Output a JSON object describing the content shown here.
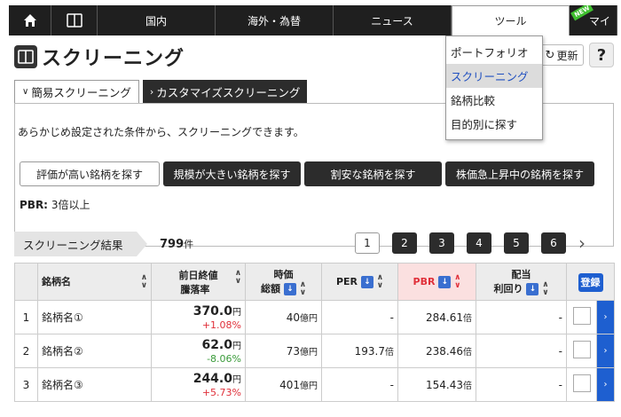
{
  "nav": {
    "items": [
      "国内",
      "海外・為替",
      "ニュース",
      "ツール"
    ],
    "extra": "マイ",
    "new_badge": "NEW"
  },
  "title": "スクリーニング",
  "refresh_label": "更新",
  "help_label": "?",
  "tabs": {
    "simple": "簡易スクリーニング",
    "custom": "カスタマイズスクリーニング"
  },
  "description": "あらかじめ設定された条件から、スクリーニングできます。",
  "presets": [
    "評価が高い銘柄を探す",
    "規模が大きい銘柄を探す",
    "割安な銘柄を探す",
    "株価急上昇中の銘柄を探す"
  ],
  "condition": {
    "label": "PBR:",
    "value": "3倍以上"
  },
  "results": {
    "label": "スクリーニング結果",
    "count": "799",
    "count_unit": "件"
  },
  "pager": [
    "1",
    "2",
    "3",
    "4",
    "5",
    "6"
  ],
  "table": {
    "headers": {
      "name": "銘柄名",
      "price_line1": "前日終値",
      "price_line2": "騰落率",
      "mcap_line1": "時価",
      "mcap_line2": "総額",
      "per": "PER",
      "pbr": "PBR",
      "div_line1": "配当",
      "div_line2": "利回り",
      "register": "登録"
    },
    "rows": [
      {
        "idx": "1",
        "name": "銘柄名①",
        "price": "370.0",
        "price_unit": "円",
        "change": "+1.08%",
        "mcap": "40",
        "mcap_unit": "億円",
        "per": "-",
        "per_unit": "",
        "pbr": "284.61",
        "pbr_unit": "倍",
        "div": "-"
      },
      {
        "idx": "2",
        "name": "銘柄名②",
        "price": "62.0",
        "price_unit": "円",
        "change": "-8.06%",
        "mcap": "73",
        "mcap_unit": "億円",
        "per": "193.7",
        "per_unit": "倍",
        "pbr": "238.46",
        "pbr_unit": "倍",
        "div": "-"
      },
      {
        "idx": "3",
        "name": "銘柄名③",
        "price": "244.0",
        "price_unit": "円",
        "change": "+5.73%",
        "mcap": "401",
        "mcap_unit": "億円",
        "per": "-",
        "per_unit": "",
        "pbr": "154.43",
        "pbr_unit": "倍",
        "div": "-"
      }
    ]
  },
  "dropdown": [
    "ポートフォリオ",
    "スクリーニング",
    "銘柄比較",
    "目的別に探す"
  ],
  "colors": {
    "accent_blue": "#1e5fd0",
    "up_red": "#e0303a",
    "down_green": "#3a9b3a"
  }
}
